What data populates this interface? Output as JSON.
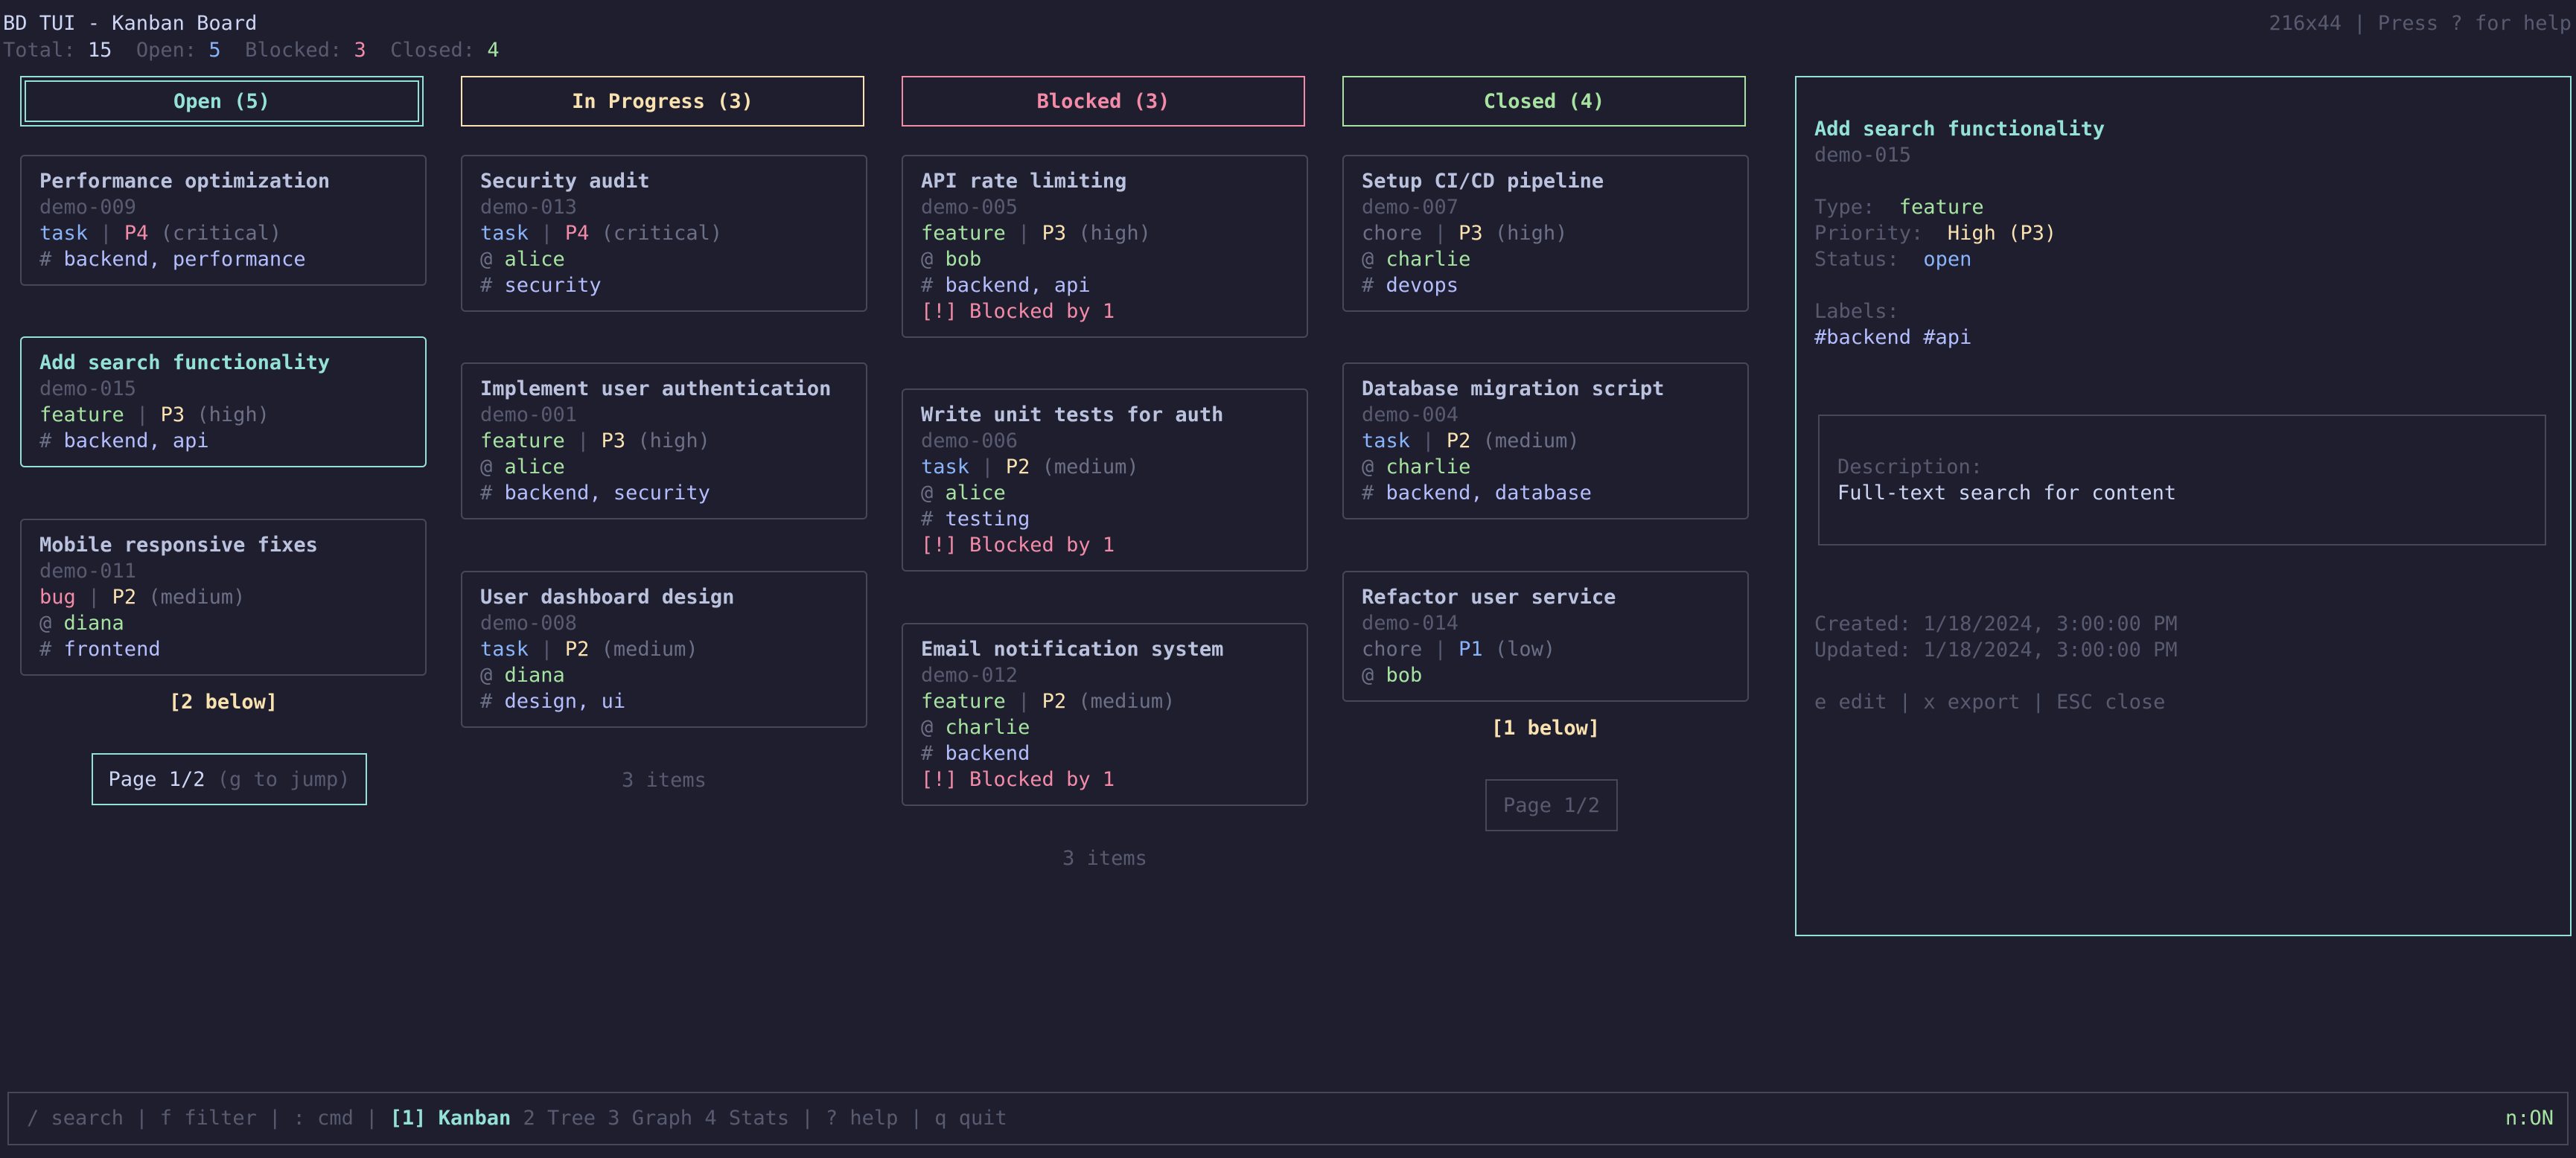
{
  "app": {
    "title": "BD TUI - Kanban Board",
    "size_hint": "216x44 | Press ? for help"
  },
  "stats": {
    "total_label": "Total:",
    "total": "15",
    "open_label": "Open:",
    "open": "5",
    "blocked_label": "Blocked:",
    "blocked": "3",
    "closed_label": "Closed:",
    "closed": "4"
  },
  "columns": [
    {
      "title": "Open (5)",
      "color": "#94e2d5"
    },
    {
      "title": "In Progress (3)",
      "color": "#f9e2af"
    },
    {
      "title": "Blocked (3)",
      "color": "#f38ba8"
    },
    {
      "title": "Closed (4)",
      "color": "#a6e3a1"
    }
  ],
  "cards": {
    "open": [
      {
        "title": "Performance optimization",
        "id": "demo-009",
        "type": "task",
        "priority": "P4",
        "severity": "(critical)",
        "labels": "backend, performance"
      },
      {
        "title": "Add search functionality",
        "id": "demo-015",
        "type": "feature",
        "priority": "P3",
        "severity": "(high)",
        "labels": "backend, api"
      },
      {
        "title": "Mobile responsive fixes",
        "id": "demo-011",
        "type": "bug",
        "priority": "P2",
        "severity": "(medium)",
        "assignee": "diana",
        "labels": "frontend"
      }
    ],
    "in_progress": [
      {
        "title": "Security audit",
        "id": "demo-013",
        "type": "task",
        "priority": "P4",
        "severity": "(critical)",
        "assignee": "alice",
        "labels": "security"
      },
      {
        "title": "Implement user authentication",
        "id": "demo-001",
        "type": "feature",
        "priority": "P3",
        "severity": "(high)",
        "assignee": "alice",
        "labels": "backend, security"
      },
      {
        "title": "User dashboard design",
        "id": "demo-008",
        "type": "task",
        "priority": "P2",
        "severity": "(medium)",
        "assignee": "diana",
        "labels": "design, ui"
      }
    ],
    "blocked": [
      {
        "title": "API rate limiting",
        "id": "demo-005",
        "type": "feature",
        "priority": "P3",
        "severity": "(high)",
        "assignee": "bob",
        "labels": "backend, api",
        "blocked": "[!] Blocked by 1"
      },
      {
        "title": "Write unit tests for auth",
        "id": "demo-006",
        "type": "task",
        "priority": "P2",
        "severity": "(medium)",
        "assignee": "alice",
        "labels": "testing",
        "blocked": "[!] Blocked by 1"
      },
      {
        "title": "Email notification system",
        "id": "demo-012",
        "type": "feature",
        "priority": "P2",
        "severity": "(medium)",
        "assignee": "charlie",
        "labels": "backend",
        "blocked": "[!] Blocked by 1"
      }
    ],
    "closed": [
      {
        "title": "Setup CI/CD pipeline",
        "id": "demo-007",
        "type": "chore",
        "priority": "P3",
        "severity": "(high)",
        "assignee": "charlie",
        "labels": "devops"
      },
      {
        "title": "Database migration script",
        "id": "demo-004",
        "type": "task",
        "priority": "P2",
        "severity": "(medium)",
        "assignee": "charlie",
        "labels": "backend, database"
      },
      {
        "title": "Refactor user service",
        "id": "demo-014",
        "type": "chore",
        "priority": "P1",
        "severity": "(low)",
        "assignee": "bob"
      }
    ]
  },
  "symbols": {
    "sep": "|",
    "assignee": "@",
    "label": "#"
  },
  "open_below": "[2 below]",
  "open_pager": {
    "page": "Page 1/2",
    "hint": "(g to jump)"
  },
  "in_progress_count": "3 items",
  "blocked_count": "3 items",
  "closed_below": "[1 below]",
  "closed_pager": "Page 1/2",
  "detail": {
    "title": "Add search functionality",
    "id": "demo-015",
    "type_label": "Type:",
    "type": "feature",
    "priority_label": "Priority:",
    "priority": "High (P3)",
    "status_label": "Status:",
    "status": "open",
    "labels_label": "Labels:",
    "labels": "#backend #api",
    "description_label": "Description:",
    "description": "Full-text search for content",
    "created": "Created: 1/18/2024, 3:00:00 PM",
    "updated": "Updated: 1/18/2024, 3:00:00 PM",
    "keys": "e edit | x export | ESC close"
  },
  "statusbar": {
    "prefix": "/ search | f filter | : cmd |",
    "active_view": "[1] Kanban",
    "views": "2 Tree 3 Graph 4 Stats",
    "suffix": "| ? help | q quit",
    "mode": "n:ON"
  }
}
